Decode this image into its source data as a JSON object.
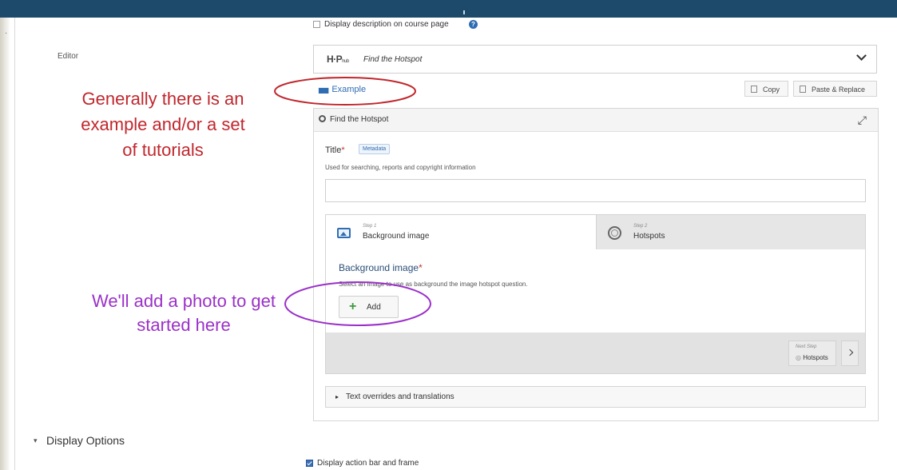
{
  "settings": {
    "display_description_label": "Display description on course page",
    "display_description_checked": false,
    "help_icon": "question-circle-icon"
  },
  "editor": {
    "label": "Editor",
    "logo_text": "H·P",
    "logo_sub": "hub",
    "selected_content_type": "Find the Hotspot",
    "example_link": "Example",
    "copy_label": "Copy",
    "paste_label": "Paste & Replace"
  },
  "panel": {
    "title": "Find the Hotspot",
    "title_field_label": "Title",
    "required_mark": "*",
    "metadata_tag": "Metadata",
    "title_field_desc": "Used for searching, reports and copyright information",
    "title_value": ""
  },
  "wizard": {
    "steps": [
      {
        "step_caption": "Step 1",
        "label": "Background image",
        "icon": "image-icon",
        "active": true
      },
      {
        "step_caption": "Step 2",
        "label": "Hotspots",
        "icon": "hotspot-ring-icon",
        "active": false
      }
    ],
    "field_label": "Background image",
    "field_desc": "Select an image to use as background the image hotspot question.",
    "add_label": "Add",
    "next_caption": "Next Step",
    "next_label": "Hotspots"
  },
  "overrides_label": "Text overrides and translations",
  "display_options": {
    "heading": "Display Options",
    "action_bar_label": "Display action bar and frame",
    "action_bar_checked": true
  },
  "annotations": {
    "red_note": "Generally there is an example and/or a set of tutorials",
    "purple_note": "We'll add a photo to get started here",
    "red_color": "#c1272d",
    "purple_color": "#9b30c9"
  },
  "colors": {
    "topbar": "#1d4a6b",
    "accent": "#2f6db3",
    "add_green": "#3c9a3c"
  }
}
